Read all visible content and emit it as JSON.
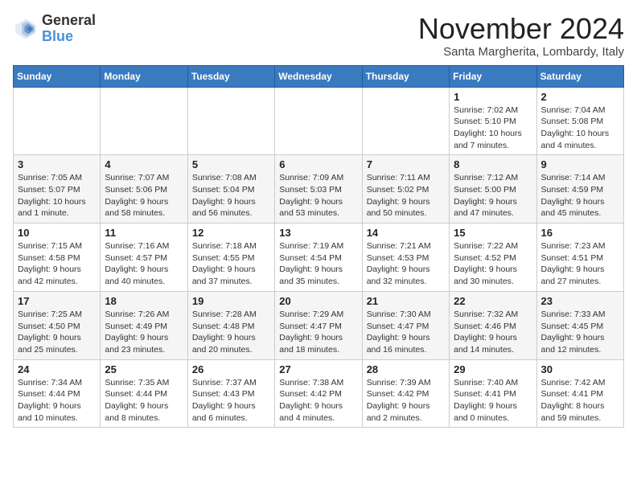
{
  "header": {
    "logo_general": "General",
    "logo_blue": "Blue",
    "month_title": "November 2024",
    "location": "Santa Margherita, Lombardy, Italy"
  },
  "weekdays": [
    "Sunday",
    "Monday",
    "Tuesday",
    "Wednesday",
    "Thursday",
    "Friday",
    "Saturday"
  ],
  "weeks": [
    [
      {
        "day": "",
        "info": ""
      },
      {
        "day": "",
        "info": ""
      },
      {
        "day": "",
        "info": ""
      },
      {
        "day": "",
        "info": ""
      },
      {
        "day": "",
        "info": ""
      },
      {
        "day": "1",
        "info": "Sunrise: 7:02 AM\nSunset: 5:10 PM\nDaylight: 10 hours and 7 minutes."
      },
      {
        "day": "2",
        "info": "Sunrise: 7:04 AM\nSunset: 5:08 PM\nDaylight: 10 hours and 4 minutes."
      }
    ],
    [
      {
        "day": "3",
        "info": "Sunrise: 7:05 AM\nSunset: 5:07 PM\nDaylight: 10 hours and 1 minute."
      },
      {
        "day": "4",
        "info": "Sunrise: 7:07 AM\nSunset: 5:06 PM\nDaylight: 9 hours and 58 minutes."
      },
      {
        "day": "5",
        "info": "Sunrise: 7:08 AM\nSunset: 5:04 PM\nDaylight: 9 hours and 56 minutes."
      },
      {
        "day": "6",
        "info": "Sunrise: 7:09 AM\nSunset: 5:03 PM\nDaylight: 9 hours and 53 minutes."
      },
      {
        "day": "7",
        "info": "Sunrise: 7:11 AM\nSunset: 5:02 PM\nDaylight: 9 hours and 50 minutes."
      },
      {
        "day": "8",
        "info": "Sunrise: 7:12 AM\nSunset: 5:00 PM\nDaylight: 9 hours and 47 minutes."
      },
      {
        "day": "9",
        "info": "Sunrise: 7:14 AM\nSunset: 4:59 PM\nDaylight: 9 hours and 45 minutes."
      }
    ],
    [
      {
        "day": "10",
        "info": "Sunrise: 7:15 AM\nSunset: 4:58 PM\nDaylight: 9 hours and 42 minutes."
      },
      {
        "day": "11",
        "info": "Sunrise: 7:16 AM\nSunset: 4:57 PM\nDaylight: 9 hours and 40 minutes."
      },
      {
        "day": "12",
        "info": "Sunrise: 7:18 AM\nSunset: 4:55 PM\nDaylight: 9 hours and 37 minutes."
      },
      {
        "day": "13",
        "info": "Sunrise: 7:19 AM\nSunset: 4:54 PM\nDaylight: 9 hours and 35 minutes."
      },
      {
        "day": "14",
        "info": "Sunrise: 7:21 AM\nSunset: 4:53 PM\nDaylight: 9 hours and 32 minutes."
      },
      {
        "day": "15",
        "info": "Sunrise: 7:22 AM\nSunset: 4:52 PM\nDaylight: 9 hours and 30 minutes."
      },
      {
        "day": "16",
        "info": "Sunrise: 7:23 AM\nSunset: 4:51 PM\nDaylight: 9 hours and 27 minutes."
      }
    ],
    [
      {
        "day": "17",
        "info": "Sunrise: 7:25 AM\nSunset: 4:50 PM\nDaylight: 9 hours and 25 minutes."
      },
      {
        "day": "18",
        "info": "Sunrise: 7:26 AM\nSunset: 4:49 PM\nDaylight: 9 hours and 23 minutes."
      },
      {
        "day": "19",
        "info": "Sunrise: 7:28 AM\nSunset: 4:48 PM\nDaylight: 9 hours and 20 minutes."
      },
      {
        "day": "20",
        "info": "Sunrise: 7:29 AM\nSunset: 4:47 PM\nDaylight: 9 hours and 18 minutes."
      },
      {
        "day": "21",
        "info": "Sunrise: 7:30 AM\nSunset: 4:47 PM\nDaylight: 9 hours and 16 minutes."
      },
      {
        "day": "22",
        "info": "Sunrise: 7:32 AM\nSunset: 4:46 PM\nDaylight: 9 hours and 14 minutes."
      },
      {
        "day": "23",
        "info": "Sunrise: 7:33 AM\nSunset: 4:45 PM\nDaylight: 9 hours and 12 minutes."
      }
    ],
    [
      {
        "day": "24",
        "info": "Sunrise: 7:34 AM\nSunset: 4:44 PM\nDaylight: 9 hours and 10 minutes."
      },
      {
        "day": "25",
        "info": "Sunrise: 7:35 AM\nSunset: 4:44 PM\nDaylight: 9 hours and 8 minutes."
      },
      {
        "day": "26",
        "info": "Sunrise: 7:37 AM\nSunset: 4:43 PM\nDaylight: 9 hours and 6 minutes."
      },
      {
        "day": "27",
        "info": "Sunrise: 7:38 AM\nSunset: 4:42 PM\nDaylight: 9 hours and 4 minutes."
      },
      {
        "day": "28",
        "info": "Sunrise: 7:39 AM\nSunset: 4:42 PM\nDaylight: 9 hours and 2 minutes."
      },
      {
        "day": "29",
        "info": "Sunrise: 7:40 AM\nSunset: 4:41 PM\nDaylight: 9 hours and 0 minutes."
      },
      {
        "day": "30",
        "info": "Sunrise: 7:42 AM\nSunset: 4:41 PM\nDaylight: 8 hours and 59 minutes."
      }
    ]
  ]
}
